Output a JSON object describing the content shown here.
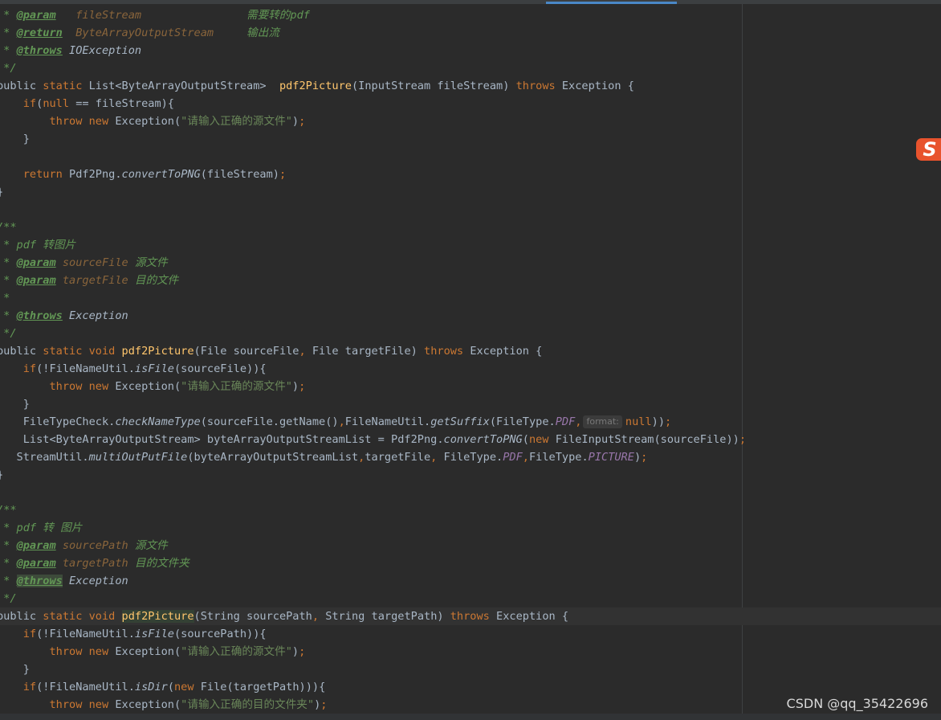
{
  "editor": {
    "lines": [
      [
        [
          "cm",
          " * "
        ],
        [
          "tag",
          "@param"
        ],
        [
          "pname",
          "   fileStream"
        ],
        [
          "cm",
          "                需要转的pdf"
        ]
      ],
      [
        [
          "cm",
          " * "
        ],
        [
          "tag",
          "@return"
        ],
        [
          "pname",
          "  ByteArrayOutputStream"
        ],
        [
          "cm",
          "     输出流"
        ]
      ],
      [
        [
          "cm",
          " * "
        ],
        [
          "tag",
          "@throws"
        ],
        [
          "cm",
          " "
        ],
        [
          "cl",
          "IOException"
        ]
      ],
      [
        [
          "cm",
          " */"
        ]
      ],
      [
        [
          "p",
          "public "
        ],
        [
          "kw",
          "static "
        ],
        [
          "p",
          "List<ByteArrayOutputStream>  "
        ],
        [
          "fn",
          "pdf2Picture"
        ],
        [
          "p",
          "(InputStream fileStream) "
        ],
        [
          "kw",
          "throws "
        ],
        [
          "p",
          "Exception {"
        ]
      ],
      [
        [
          "p",
          "    "
        ],
        [
          "kw",
          "if"
        ],
        [
          "p",
          "("
        ],
        [
          "kw",
          "null "
        ],
        [
          "p",
          "== fileStream){"
        ]
      ],
      [
        [
          "p",
          "        "
        ],
        [
          "kw",
          "throw new "
        ],
        [
          "p",
          "Exception("
        ],
        [
          "str",
          "\"请输入正确的源文件\""
        ],
        [
          "p",
          ")"
        ],
        [
          "pn",
          ";"
        ]
      ],
      [
        [
          "p",
          "    }"
        ]
      ],
      [],
      [
        [
          "p",
          "    "
        ],
        [
          "kw",
          "return "
        ],
        [
          "p",
          "Pdf2Png."
        ],
        [
          "it",
          "convertToPNG"
        ],
        [
          "p",
          "(fileStream)"
        ],
        [
          "pn",
          ";"
        ]
      ],
      [
        [
          "p",
          "}"
        ]
      ],
      [],
      [
        [
          "cm",
          "/**"
        ]
      ],
      [
        [
          "cm",
          " * pdf 转图片"
        ]
      ],
      [
        [
          "cm",
          " * "
        ],
        [
          "tag",
          "@param"
        ],
        [
          "pname",
          " sourceFile"
        ],
        [
          "cm",
          " 源文件"
        ]
      ],
      [
        [
          "cm",
          " * "
        ],
        [
          "tag",
          "@param"
        ],
        [
          "pname",
          " targetFile"
        ],
        [
          "cm",
          " 目的文件"
        ]
      ],
      [
        [
          "cm",
          " *"
        ]
      ],
      [
        [
          "cm",
          " * "
        ],
        [
          "tag",
          "@throws"
        ],
        [
          "cm",
          " "
        ],
        [
          "cl",
          "Exception"
        ]
      ],
      [
        [
          "cm",
          " */"
        ]
      ],
      [
        [
          "p",
          "public "
        ],
        [
          "kw",
          "static void "
        ],
        [
          "fn",
          "pdf2Picture"
        ],
        [
          "p",
          "(File sourceFile"
        ],
        [
          "pn",
          ", "
        ],
        [
          "p",
          "File targetFile) "
        ],
        [
          "kw",
          "throws "
        ],
        [
          "p",
          "Exception {"
        ]
      ],
      [
        [
          "p",
          "    "
        ],
        [
          "kw",
          "if"
        ],
        [
          "p",
          "(!FileNameUtil."
        ],
        [
          "it",
          "isFile"
        ],
        [
          "p",
          "(sourceFile)){"
        ]
      ],
      [
        [
          "p",
          "        "
        ],
        [
          "kw",
          "throw new "
        ],
        [
          "p",
          "Exception("
        ],
        [
          "str",
          "\"请输入正确的源文件\""
        ],
        [
          "p",
          ")"
        ],
        [
          "pn",
          ";"
        ]
      ],
      [
        [
          "p",
          "    }"
        ]
      ],
      [
        [
          "p",
          "    FileTypeCheck."
        ],
        [
          "it",
          "checkNameType"
        ],
        [
          "p",
          "(sourceFile.getName()"
        ],
        [
          "pn",
          ","
        ],
        [
          "p",
          "FileNameUtil."
        ],
        [
          "it",
          "getSuffix"
        ],
        [
          "p",
          "(FileType."
        ],
        [
          "const",
          "PDF"
        ],
        [
          "pn",
          ","
        ],
        [
          "hint",
          "format:"
        ],
        [
          "kw",
          "null"
        ],
        [
          "p",
          "))"
        ],
        [
          "pn",
          ";"
        ]
      ],
      [
        [
          "p",
          "    List<ByteArrayOutputStream> byteArrayOutputStreamList = Pdf2Png."
        ],
        [
          "it",
          "convertToPNG"
        ],
        [
          "p",
          "("
        ],
        [
          "kw",
          "new "
        ],
        [
          "p",
          "FileInputStream(sourceFile))"
        ],
        [
          "pn",
          ";"
        ]
      ],
      [
        [
          "p",
          "   StreamUtil."
        ],
        [
          "it",
          "multiOutPutFile"
        ],
        [
          "p",
          "(byteArrayOutputStreamList"
        ],
        [
          "pn",
          ","
        ],
        [
          "p",
          "targetFile"
        ],
        [
          "pn",
          ", "
        ],
        [
          "p",
          "FileType."
        ],
        [
          "const",
          "PDF"
        ],
        [
          "pn",
          ","
        ],
        [
          "p",
          "FileType."
        ],
        [
          "const",
          "PICTURE"
        ],
        [
          "p",
          ")"
        ],
        [
          "pn",
          ";"
        ]
      ],
      [
        [
          "p",
          "}"
        ]
      ],
      [],
      [
        [
          "cm",
          "/**"
        ]
      ],
      [
        [
          "cm",
          " * pdf 转 图片"
        ]
      ],
      [
        [
          "cm",
          " * "
        ],
        [
          "tag",
          "@param"
        ],
        [
          "pname",
          " sourcePath"
        ],
        [
          "cm",
          " 源文件"
        ]
      ],
      [
        [
          "cm",
          " * "
        ],
        [
          "tag",
          "@param"
        ],
        [
          "pname",
          " targetPath"
        ],
        [
          "cm",
          " 目的文件夹"
        ]
      ],
      [
        [
          "cm",
          " * "
        ],
        [
          "tagbox",
          "@throws"
        ],
        [
          "cm",
          " "
        ],
        [
          "cl",
          "Exception"
        ]
      ],
      [
        [
          "cm",
          " */"
        ]
      ],
      [
        [
          "p",
          "public "
        ],
        [
          "kw",
          "static void "
        ],
        [
          "fnhl",
          "pdf2Picture"
        ],
        [
          "p",
          "(String sourcePath"
        ],
        [
          "pn",
          ", "
        ],
        [
          "p",
          "String targetPath) "
        ],
        [
          "kw",
          "throws "
        ],
        [
          "p",
          "Exception {"
        ]
      ],
      [
        [
          "p",
          "    "
        ],
        [
          "kw",
          "if"
        ],
        [
          "p",
          "(!FileNameUtil."
        ],
        [
          "it",
          "isFile"
        ],
        [
          "p",
          "(sourcePath)){"
        ]
      ],
      [
        [
          "p",
          "        "
        ],
        [
          "kw",
          "throw new "
        ],
        [
          "p",
          "Exception("
        ],
        [
          "str",
          "\"请输入正确的源文件\""
        ],
        [
          "p",
          ")"
        ],
        [
          "pn",
          ";"
        ]
      ],
      [
        [
          "p",
          "    }"
        ]
      ],
      [
        [
          "p",
          "    "
        ],
        [
          "kw",
          "if"
        ],
        [
          "p",
          "(!FileNameUtil."
        ],
        [
          "it",
          "isDir"
        ],
        [
          "p",
          "("
        ],
        [
          "kw",
          "new "
        ],
        [
          "p",
          "File(targetPath))){"
        ]
      ],
      [
        [
          "p",
          "        "
        ],
        [
          "kw",
          "throw new "
        ],
        [
          "p",
          "Exception("
        ],
        [
          "str",
          "\"请输入正确的目的文件夹\""
        ],
        [
          "p",
          ")"
        ],
        [
          "pn",
          ";"
        ]
      ]
    ]
  },
  "overlay": {
    "ime_icon": "S",
    "ime_icon_name": "sogou-ime-icon"
  },
  "watermark": "CSDN @qq_35422696",
  "colors": {
    "background": "#2b2b2b",
    "keyword": "#cc7832",
    "method": "#ffc66d",
    "string": "#6a8759",
    "comment": "#629755",
    "constant": "#9876aa",
    "text": "#a9b7c6"
  }
}
